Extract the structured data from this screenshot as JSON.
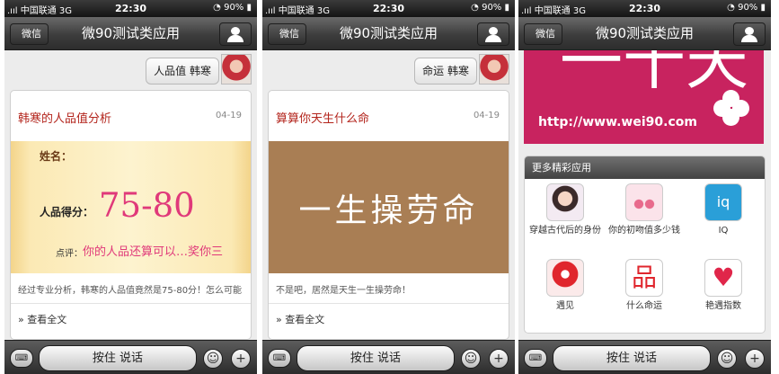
{
  "statusbar": {
    "carrier": "中国联通",
    "network": "3G",
    "time": "22:30",
    "battery": "90%"
  },
  "titlebar": {
    "back": "微信",
    "title": "微90测试类应用"
  },
  "bottombar": {
    "hold_to_talk": "按住 说话"
  },
  "screens": [
    {
      "sent_message": "人品值 韩寒",
      "card": {
        "title": "韩寒的人品值分析",
        "date": "04-19",
        "image": {
          "name_label": "姓名：",
          "score_label": "人品得分：",
          "score": "75-80",
          "comment_label": "点评：",
          "comment": "你的人品还算可以…奖你三"
        },
        "description": "经过专业分析，韩寒的人品值竟然是75-80分！怎么可能",
        "read_more": "» 查看全文"
      }
    },
    {
      "sent_message": "命运 韩寒",
      "card": {
        "title": "算算你天生什么命",
        "date": "04-19",
        "image": {
          "fate": "一生操劳命"
        },
        "description": "不是吧，居然是天生一生操劳命！",
        "read_more": "» 查看全文"
      }
    },
    {
      "banner": {
        "url": "http://www.wei90.com"
      },
      "more_apps": {
        "header": "更多精彩应用",
        "items": [
          {
            "label": "穿越古代后的身份",
            "icon": "ancient-girl-icon"
          },
          {
            "label": "你的初吻值多少钱",
            "icon": "kiss-birds-icon"
          },
          {
            "label": "IQ",
            "icon": "iq-icon",
            "icon_text": "iq"
          },
          {
            "label": "遇见",
            "icon": "map-pin-icon"
          },
          {
            "label": "什么命运",
            "icon": "destiny-icon",
            "icon_text": "品"
          },
          {
            "label": "艳遇指数",
            "icon": "heart-icon"
          }
        ]
      }
    }
  ],
  "colors": {
    "accent_red": "#b3241c",
    "score_pink": "#e0397a",
    "banner_magenta": "#c8235f",
    "brown": "#a97e54"
  }
}
